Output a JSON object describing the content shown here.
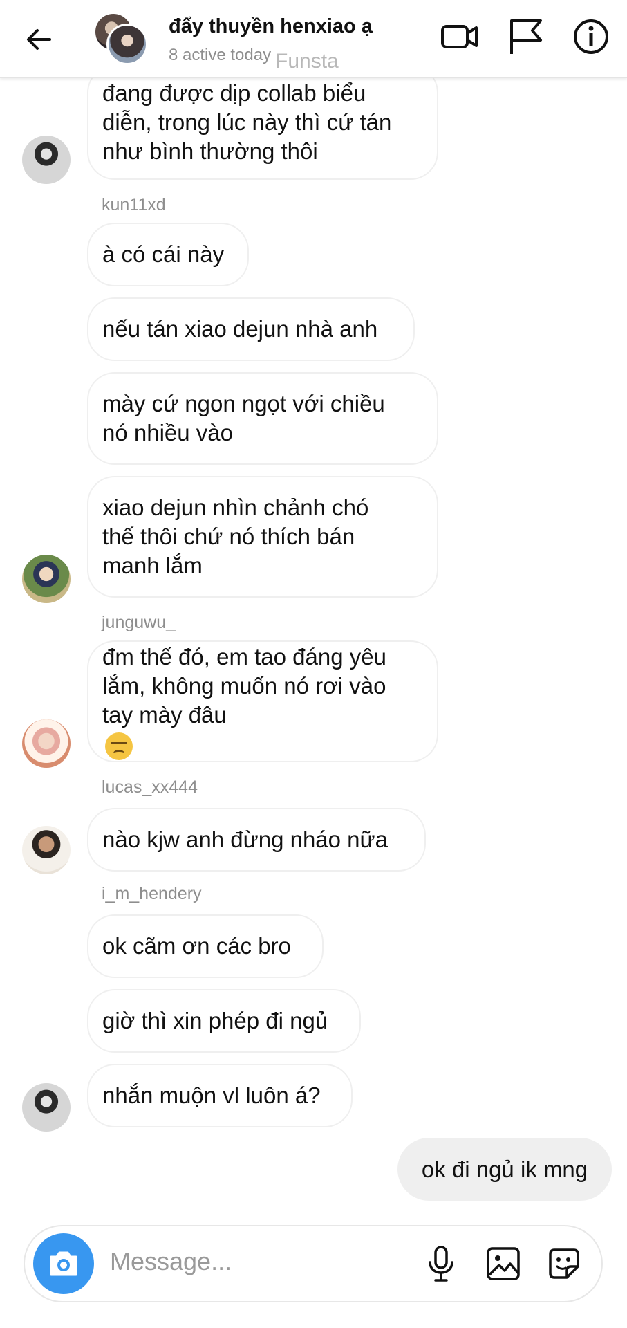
{
  "header": {
    "title": "đẩy thuyền henxiao ạ",
    "status": "8 active today",
    "watermark": "Funsta",
    "icons": [
      "back-arrow-icon",
      "video-call-icon",
      "flag-icon",
      "info-icon"
    ]
  },
  "messages": [
    {
      "lines": [
        "đang được dịp collab biểu",
        "diễn, trong lúc này thì cứ tán",
        "như bình thường thôi"
      ],
      "avatar": "av-a"
    },
    {
      "username": "kun11xd"
    },
    {
      "lines": [
        "à có cái này"
      ]
    },
    {
      "lines": [
        "nếu tán xiao dejun nhà anh"
      ]
    },
    {
      "lines": [
        "mày cứ ngon ngọt với chiều",
        "nó nhiều vào"
      ]
    },
    {
      "lines": [
        "xiao dejun nhìn chảnh chó",
        "thế thôi chứ nó thích bán",
        "manh lắm"
      ],
      "avatar": "av-b"
    },
    {
      "username": "junguwu_"
    },
    {
      "lines": [
        "đm thế đó, em tao đáng yêu",
        "lắm, không muốn nó rơi vào",
        "tay mày đâu"
      ],
      "emoji": "angry-face-emoji",
      "avatar": "av-c"
    },
    {
      "username": "lucas_xx444"
    },
    {
      "lines": [
        "nào kjw anh đừng nháo nữa"
      ],
      "avatar": "av-d"
    },
    {
      "username": "i_m_hendery"
    },
    {
      "lines": [
        "ok cãm ơn các bro"
      ]
    },
    {
      "lines": [
        "giờ thì xin phép đi ngủ"
      ]
    },
    {
      "lines": [
        "nhắn muộn vl luôn á?"
      ],
      "avatar": "av-a"
    }
  ],
  "own_message": "ok đi ngủ ik mng",
  "composer": {
    "placeholder": "Message...",
    "icons": [
      "camera-icon",
      "microphone-icon",
      "gallery-icon",
      "sticker-icon"
    ]
  },
  "colors": {
    "accent": "#3897f0",
    "bubble_border": "#efefef",
    "own_bubble": "#efefef",
    "muted_text": "#8e8e8e"
  }
}
